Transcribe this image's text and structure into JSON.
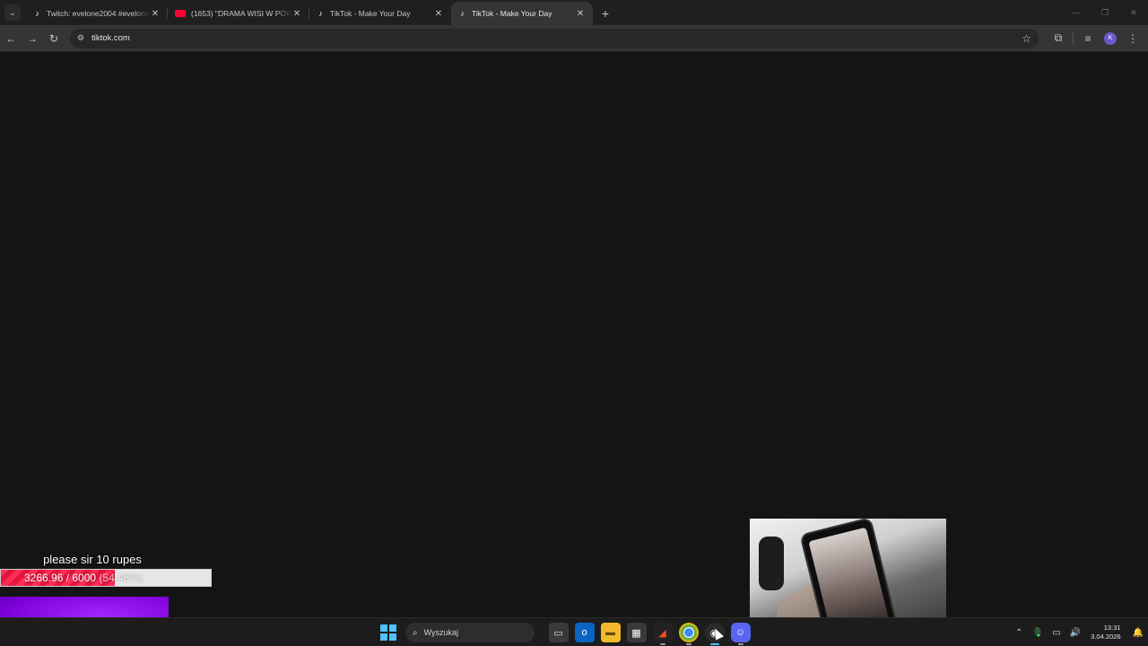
{
  "browser": {
    "tabs": [
      {
        "title": "Twitch: evelone2004 #evelone #",
        "favicon": "tiktok-icon",
        "active": false
      },
      {
        "title": "(1653) \"DRAMA WISI W POWIE",
        "favicon": "youtube-icon",
        "active": false
      },
      {
        "title": "TikTok - Make Your Day",
        "favicon": "tiktok-icon",
        "active": false
      },
      {
        "title": "TikTok - Make Your Day",
        "favicon": "tiktok-icon",
        "active": true
      }
    ],
    "new_tab_label": "+",
    "address": "tiktok.com",
    "profile_initial": "K"
  },
  "overlay": {
    "goal_text": "please sir 10 rupes",
    "goal_progress": "3266.96 / 6000",
    "goal_percent_label": "(54.45%)",
    "goal_fraction": 0.5445,
    "fill_color": "#ff2d55"
  },
  "taskbar": {
    "search_placeholder": "Wyszukaj",
    "time": "13:31",
    "date": "3.04.2026",
    "apps": [
      "task-view-icon",
      "outlook-icon",
      "file-explorer-icon",
      "store-icon",
      "media-app-icon",
      "chrome-icon",
      "obs-icon",
      "discord-icon"
    ]
  }
}
